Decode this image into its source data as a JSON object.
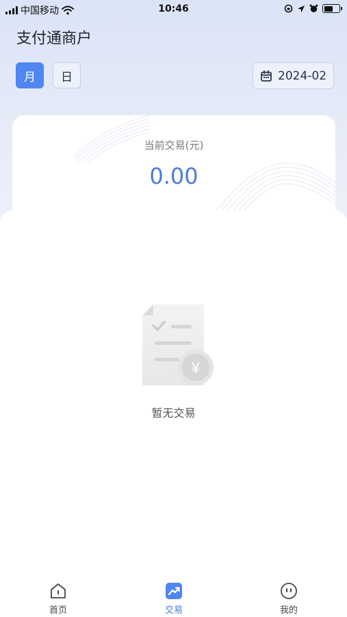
{
  "status_bar": {
    "carrier": "中国移动",
    "time": "10:46",
    "icons": [
      "signal-icon",
      "wifi-icon",
      "orientation-lock-icon",
      "location-icon",
      "alarm-icon",
      "battery-icon"
    ]
  },
  "header": {
    "title": "支付通商户"
  },
  "period_toggle": {
    "month_label": "月",
    "day_label": "日",
    "selected": "月",
    "accent_color": "#4f86f0"
  },
  "date_picker": {
    "icon": "calendar-icon",
    "value": "2024-02"
  },
  "summary": {
    "label": "当前交易(元)",
    "value": "0.00",
    "value_color": "#4a7ed3"
  },
  "empty_state": {
    "icon": "empty-receipt-icon",
    "currency_symbol": "¥",
    "text": "暂无交易"
  },
  "tab_bar": {
    "items": [
      {
        "label": "首页",
        "icon": "home-icon"
      },
      {
        "label": "交易",
        "icon": "trend-icon"
      },
      {
        "label": "我的",
        "icon": "profile-icon"
      }
    ],
    "active": "交易",
    "active_color": "#4a7ed3"
  }
}
